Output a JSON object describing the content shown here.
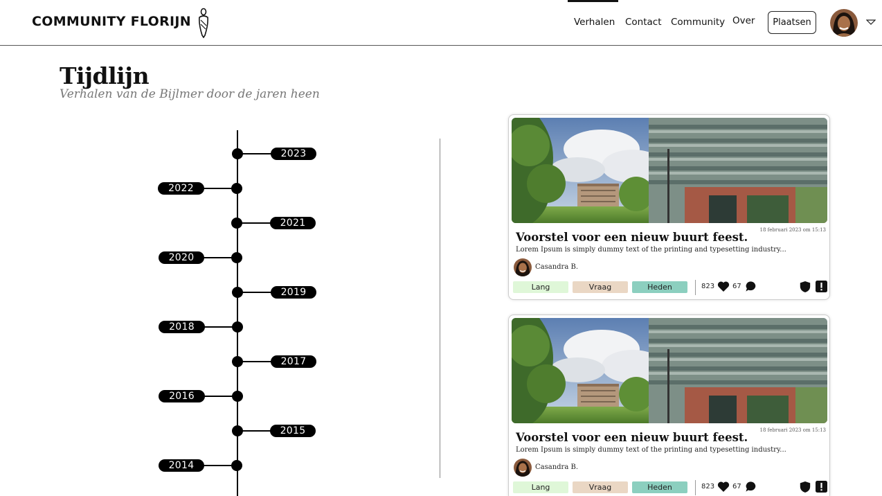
{
  "header": {
    "brand": "COMMUNITY FLORIJN",
    "nav": [
      {
        "label": "Verhalen",
        "active": true
      },
      {
        "label": "Contact"
      },
      {
        "label": "Community"
      },
      {
        "label": "Over"
      }
    ],
    "post_button": "Plaatsen"
  },
  "page": {
    "title": "Tijdlijn",
    "subtitle": "Verhalen van de Bijlmer door de jaren heen"
  },
  "timeline": {
    "years": [
      "2023",
      "2022",
      "2021",
      "2020",
      "2019",
      "2018",
      "2017",
      "2016",
      "2015",
      "2014"
    ]
  },
  "cards": [
    {
      "date": "18 februari 2023 om 15:13",
      "title": "Voorstel voor een nieuw buurt feest.",
      "excerpt": "Lorem Ipsum is simply dummy text of the printing and typesetting industry...",
      "author": "Casandra B.",
      "tags": [
        {
          "label": "Lang",
          "color": "#dff7d8"
        },
        {
          "label": "Vraag",
          "color": "#ead7c4"
        },
        {
          "label": "Heden",
          "color": "#8ccfbf"
        }
      ],
      "likes": "823",
      "comments": "67"
    },
    {
      "date": "18 februari 2023 om 15:13",
      "title": "Voorstel voor een nieuw buurt feest.",
      "excerpt": "Lorem Ipsum is simply dummy text of the printing and typesetting industry...",
      "author": "Casandra B.",
      "tags": [
        {
          "label": "Lang",
          "color": "#dff7d8"
        },
        {
          "label": "Vraag",
          "color": "#ead7c4"
        },
        {
          "label": "Heden",
          "color": "#8ccfbf"
        }
      ],
      "likes": "823",
      "comments": "67"
    }
  ],
  "icons": {
    "logo": "florijn-figure-logo",
    "dropdown": "chevron-down-icon",
    "like": "heart-icon",
    "comment": "comment-bubble-icon",
    "shield": "shield-icon",
    "report": "report-exclamation-icon"
  },
  "colors": {
    "primary": "#000000",
    "tag_lang": "#dff7d8",
    "tag_vraag": "#ead7c4",
    "tag_heden": "#8ccfbf"
  }
}
